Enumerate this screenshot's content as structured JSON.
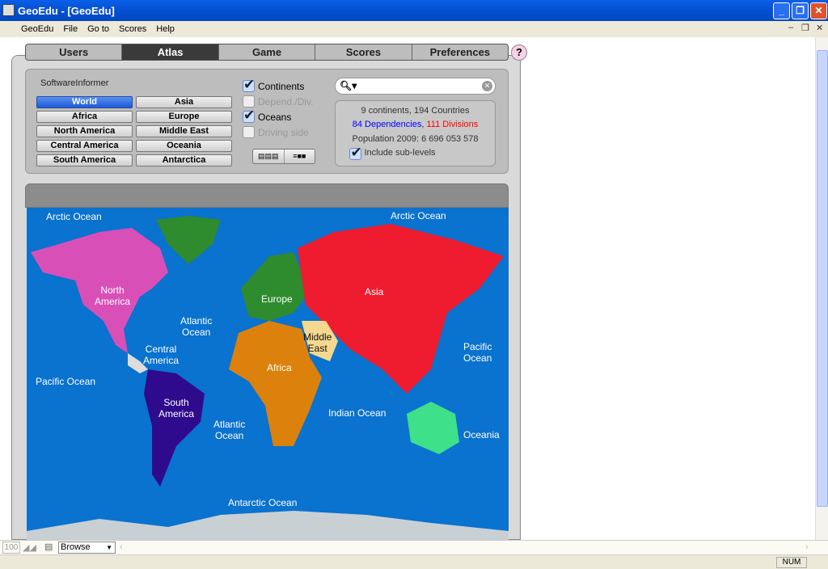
{
  "window": {
    "title": "GeoEdu - [GeoEdu]"
  },
  "menu": [
    "GeoEdu",
    "File",
    "Go to",
    "Scores",
    "Help"
  ],
  "tabs": [
    "Users",
    "Atlas",
    "Game",
    "Scores",
    "Preferences"
  ],
  "active_tab": "Atlas",
  "help_label": "?",
  "region_group_label": "SoftwareInformer",
  "regions": [
    "World",
    "Asia",
    "Africa",
    "Europe",
    "North America",
    "Middle East",
    "Central America",
    "Oceania",
    "South America",
    "Antarctica"
  ],
  "selected_region": "World",
  "options": [
    {
      "label": "Continents",
      "checked": true,
      "enabled": true
    },
    {
      "label": "Depend./Div.",
      "checked": false,
      "enabled": false
    },
    {
      "label": "Oceans",
      "checked": true,
      "enabled": true
    },
    {
      "label": "Driving side",
      "checked": false,
      "enabled": false
    }
  ],
  "search": {
    "value": "",
    "placeholder": ""
  },
  "info": {
    "line1": "9 continents, 194 Countries",
    "dependencies": "84 Dependencies",
    "sep": ", ",
    "divisions": "111 Divisions",
    "population": "Population 2009: 6 696 053 578",
    "include_sublevels": "Include sub-levels",
    "include_checked": true
  },
  "colors": {
    "dependencies": "#0000ff",
    "divisions": "#ff0000",
    "ocean": "#0a72cf",
    "asia": "#ee1c2e",
    "europe": "#2e8b2e",
    "africa": "#dc820c",
    "north_america": "#d94fb8",
    "south_america": "#2e0a8c",
    "oceania": "#3ee08a",
    "middle_east": "#f5d890",
    "antarctica": "#c8d0d4"
  },
  "map_labels": {
    "arctic1": "Arctic Ocean",
    "arctic2": "Arctic Ocean",
    "na": "North\nAmerica",
    "atlantic1": "Atlantic\nOcean",
    "europe": "Europe",
    "asia": "Asia",
    "middle_east": "Middle\nEast",
    "central": "Central\nAmerica",
    "pacific_e": "Pacific Ocean",
    "pacific_w": "Pacific\nOcean",
    "africa": "Africa",
    "sa": "South\nAmerica",
    "atlantic2": "Atlantic\nOcean",
    "indian": "Indian Ocean",
    "oceania": "Oceania",
    "antarctic": "Antarctic Ocean"
  },
  "bottom": {
    "zoom": "100",
    "mode": "Browse"
  },
  "status": {
    "num": "NUM"
  }
}
